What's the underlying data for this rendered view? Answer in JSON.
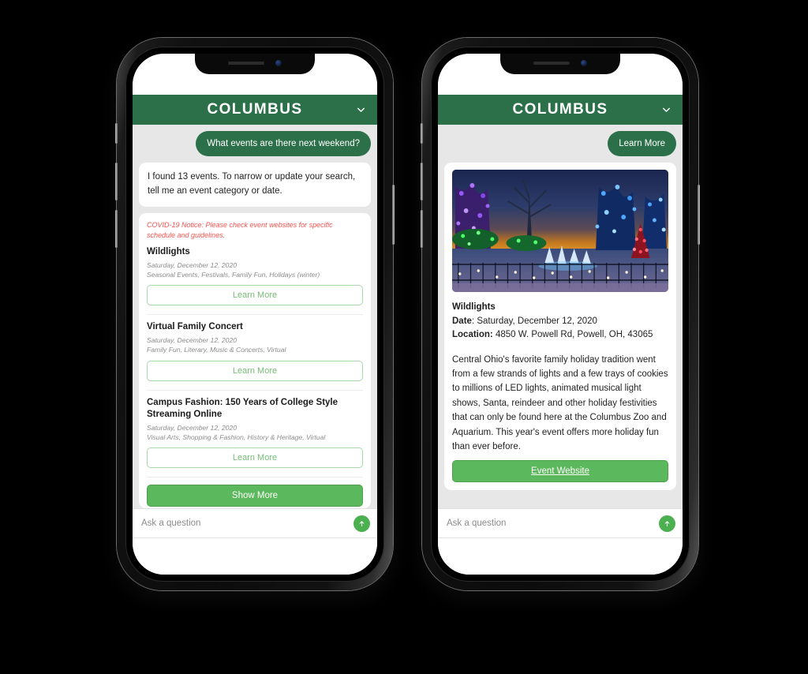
{
  "app": {
    "title": "COLUMBUS",
    "header_color": "#2b7049",
    "accent_green": "#5cb85c",
    "outline_green": "#77bd77",
    "notice_red": "#f5534e",
    "chevron_icon": "chevron-down-icon"
  },
  "phone_left": {
    "conversation": {
      "user_message": "What events are there next weekend?",
      "bot_message": "I found 13 events. To narrow or update your search, tell me an event category or date."
    },
    "results": {
      "covid_notice": "COVID-19 Notice: Please check event websites for specific schedule and guidelines.",
      "events": [
        {
          "title": "Wildlights",
          "date": "Saturday, December 12, 2020",
          "categories": "Seasonal Events, Festivals, Family Fun, Holidays (winter)",
          "button": "Learn More"
        },
        {
          "title": "Virtual Family Concert",
          "date": "Saturday, December 12, 2020",
          "categories": "Family Fun, Literary, Music & Concerts, Virtual",
          "button": "Learn More"
        },
        {
          "title": "Campus Fashion: 150 Years of College Style Streaming Online",
          "date": "Saturday, December 12, 2020",
          "categories": "Visual Arts, Shopping & Fashion, History & Heritage, Virtual",
          "button": "Learn More"
        }
      ],
      "show_more": "Show More"
    },
    "input": {
      "placeholder": "Ask a question",
      "value": "",
      "send_icon": "arrow-up-icon"
    }
  },
  "phone_right": {
    "conversation": {
      "user_message": "Learn More"
    },
    "detail": {
      "image_alt": "holiday-lights-display-photo",
      "title": "Wildlights",
      "date_label": "Date",
      "date_value": "Saturday, December 12, 2020",
      "location_label": "Location:",
      "location_value": "4850 W. Powell Rd, Powell, OH, 43065",
      "description": "Central Ohio's favorite family holiday tradition went from a few strands of lights and a few trays of cookies to millions of LED lights, animated musical light shows, Santa, reindeer and other holiday festivities that can only be found here at the Columbus Zoo and Aquarium. This year's event offers more holiday fun than ever before.",
      "website_button": "Event Website"
    },
    "input": {
      "placeholder": "Ask a question",
      "value": "",
      "send_icon": "arrow-up-icon"
    }
  }
}
